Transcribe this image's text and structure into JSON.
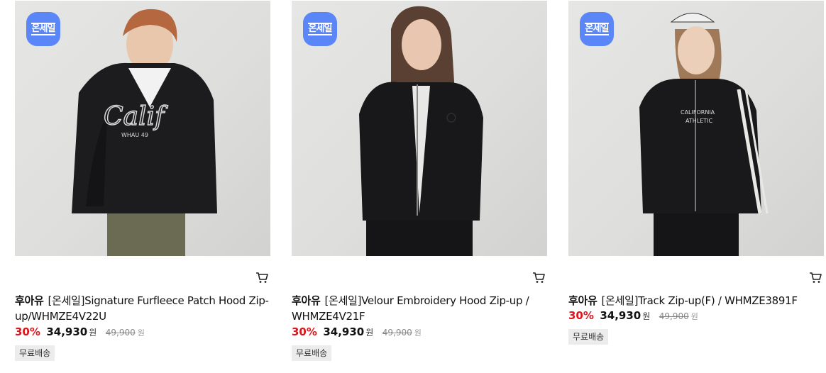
{
  "products": [
    {
      "badge": "온세일",
      "brand": "후아유",
      "name": "[온세일]Signature Furfleece Patch Hood Zip-up/WHMZE4V22U",
      "discount": "30%",
      "price": "34,930",
      "price_unit": "원",
      "original_price": "49,900",
      "original_unit": "원",
      "shipping": "무료배송",
      "graphic_text": "Calif",
      "graphic_sub": "WHAU 49"
    },
    {
      "badge": "온세일",
      "brand": "후아유",
      "name": "[온세일]Velour Embroidery Hood Zip-up / WHMZE4V21F",
      "discount": "30%",
      "price": "34,930",
      "price_unit": "원",
      "original_price": "49,900",
      "original_unit": "원",
      "shipping": "무료배송"
    },
    {
      "badge": "온세일",
      "brand": "후아유",
      "name": "[온세일]Track Zip-up(F) / WHMZE3891F",
      "discount": "30%",
      "price": "34,930",
      "price_unit": "원",
      "original_price": "49,900",
      "original_unit": "원",
      "shipping": "무료배송",
      "graphic_text": "CALIFORNIA",
      "graphic_sub": "ATHLETIC"
    }
  ],
  "colors": {
    "badge": "#5b86f7",
    "discount": "#e0131a",
    "shipping_bg": "#ececec"
  }
}
